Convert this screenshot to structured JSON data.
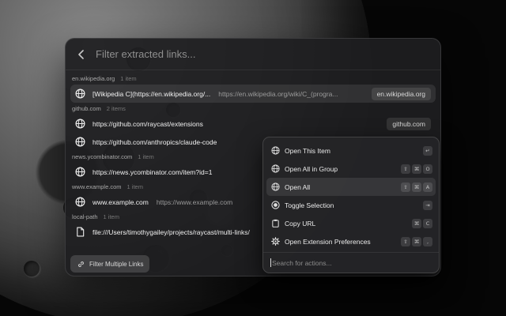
{
  "search": {
    "placeholder": "Filter extracted links..."
  },
  "sections": [
    {
      "domain": "en.wikipedia.org",
      "count": "1 item",
      "items": [
        {
          "title": "[Wikipedia C](https://en.wikipedia.org/...",
          "subtitle": "https://en.wikipedia.org/wiki/C_(progra...",
          "tag": "en.wikipedia.org",
          "icon": "globe-icon"
        }
      ]
    },
    {
      "domain": "github.com",
      "count": "2 items",
      "items": [
        {
          "title": "https://github.com/raycast/extensions",
          "subtitle": "",
          "tag": "github.com",
          "icon": "globe-icon"
        },
        {
          "title": "https://github.com/anthropics/claude-code",
          "subtitle": "",
          "tag": "",
          "icon": "globe-icon"
        }
      ]
    },
    {
      "domain": "news.ycombinator.com",
      "count": "1 item",
      "items": [
        {
          "title": "https://news.ycombinator.com/item?id=1",
          "subtitle": "",
          "tag": "",
          "icon": "globe-icon"
        }
      ]
    },
    {
      "domain": "www.example.com",
      "count": "1 item",
      "items": [
        {
          "title": "www.example.com",
          "subtitle": "https://www.example.com",
          "tag": "",
          "icon": "globe-icon"
        }
      ]
    },
    {
      "domain": "local-path",
      "count": "1 item",
      "items": [
        {
          "title": "file:///Users/timothygailey/projects/raycast/multi-links/",
          "subtitle": "",
          "tag": "",
          "icon": "file-icon"
        }
      ]
    }
  ],
  "footer": {
    "button_label": "Filter Multiple Links"
  },
  "actions": [
    {
      "label": "Open This Item",
      "icon": "globe-icon",
      "keys": [
        "↵"
      ]
    },
    {
      "label": "Open All in Group",
      "icon": "globe-icon",
      "keys": [
        "⇧",
        "⌘",
        "O"
      ]
    },
    {
      "label": "Open All",
      "icon": "globe-icon",
      "keys": [
        "⇧",
        "⌘",
        "A"
      ]
    },
    {
      "label": "Toggle Selection",
      "icon": "radio-icon",
      "keys": [
        "⇥"
      ]
    },
    {
      "label": "Copy URL",
      "icon": "clipboard-icon",
      "keys": [
        "⌘",
        "C"
      ]
    },
    {
      "label": "Open Extension Preferences",
      "icon": "gear-icon",
      "keys": [
        "⇧",
        "⌘",
        ","
      ]
    }
  ],
  "action_search": {
    "placeholder": "Search for actions..."
  },
  "colors": {
    "window_bg": "#1e1e20",
    "selected_bg": "#2f2f31",
    "text": "#e8e8e8",
    "muted": "#9a9a9a"
  }
}
